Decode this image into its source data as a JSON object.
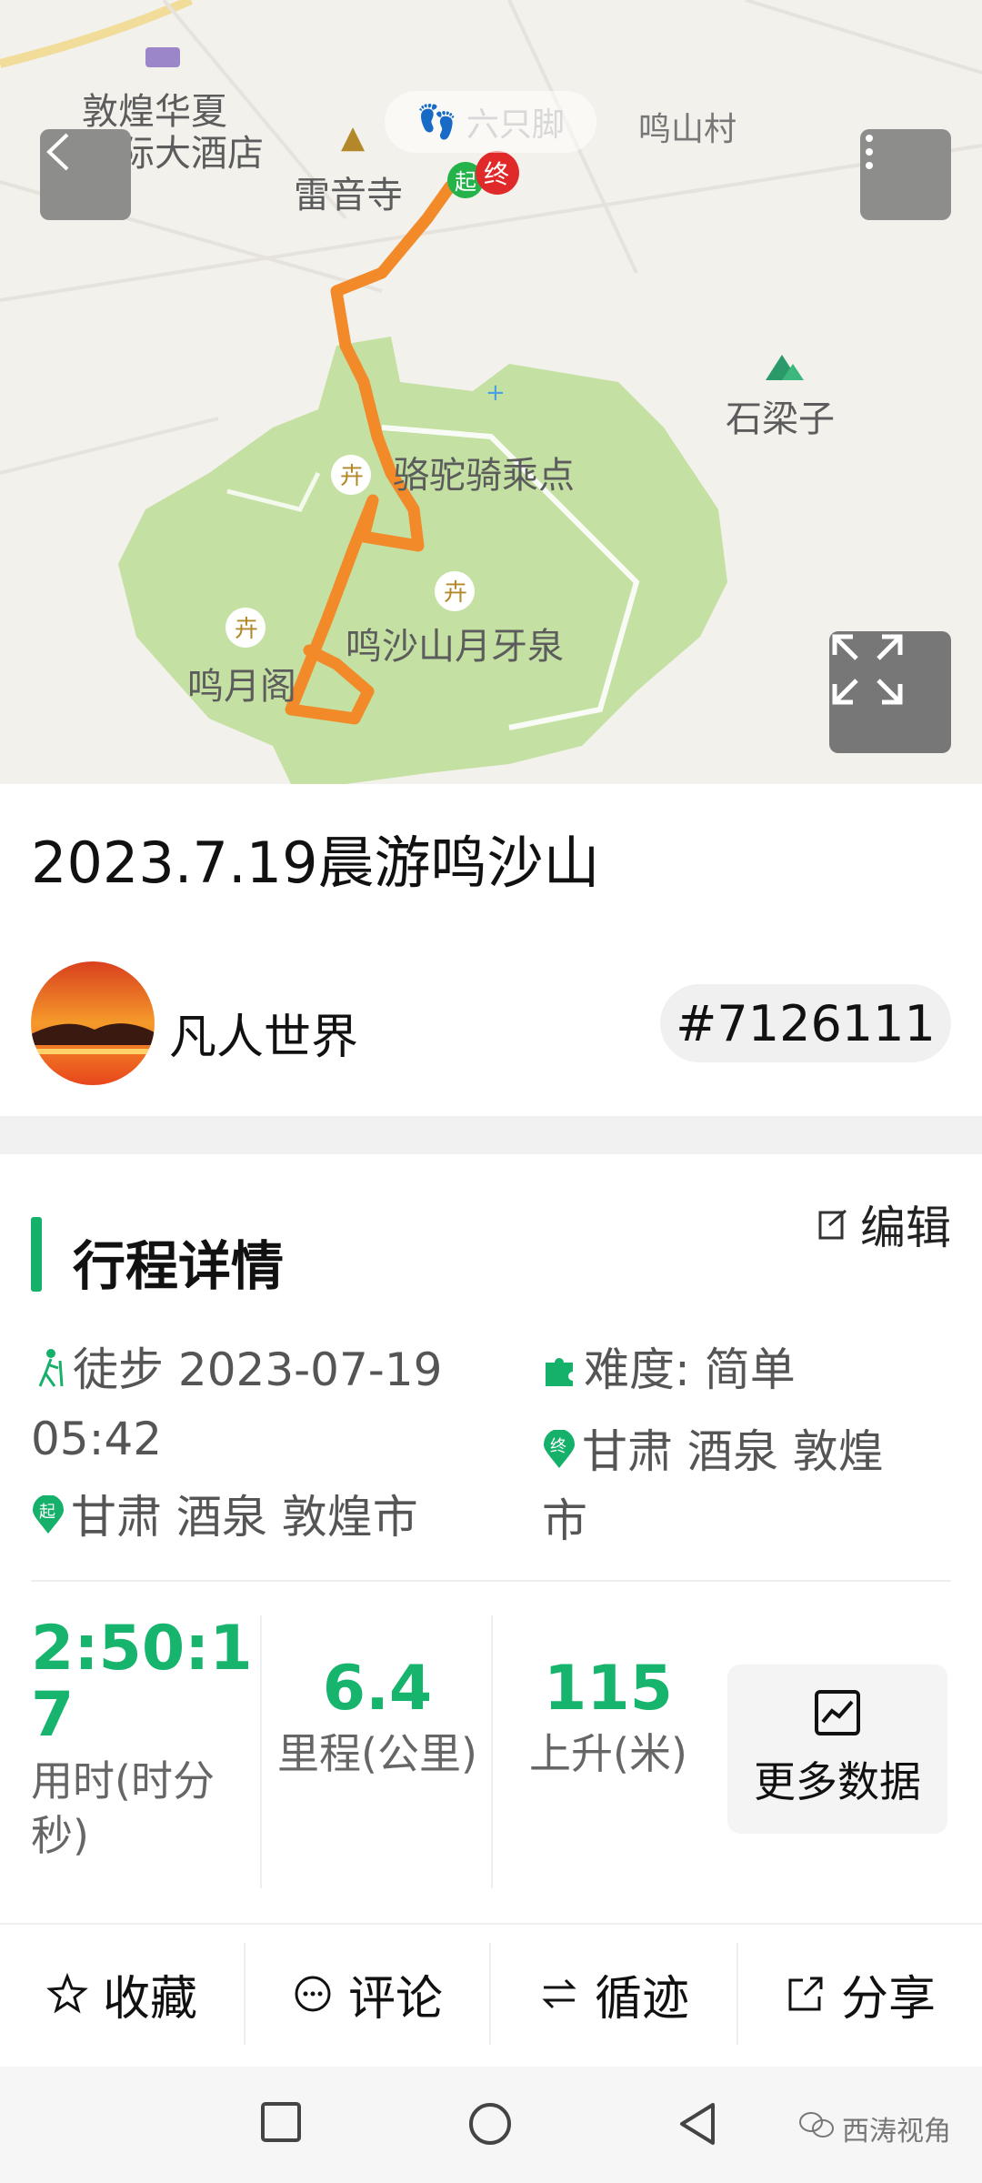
{
  "map": {
    "labels": {
      "hotel_line1": "敦煌华夏",
      "hotel_line2": "国际大酒店",
      "temple": "雷音寺",
      "village": "鸣山村",
      "stone": "石梁子",
      "camel": "骆驼骑乘点",
      "spring": "鸣沙山月牙泉",
      "pavilion": "鸣月阁"
    },
    "watermark": "六只脚",
    "start_marker": "起",
    "end_marker": "终",
    "colors": {
      "route": "#f28a2a",
      "park": "#c4e0a2",
      "land": "#f3f1ec"
    }
  },
  "trip": {
    "title": "2023.7.19晨游鸣沙山",
    "author": "凡人世界",
    "id_badge": "#7126111"
  },
  "details": {
    "section_title": "行程详情",
    "edit_label": "编辑",
    "activity": "徒步 2023-07-19",
    "time": "05:42",
    "difficulty": "难度:  简单",
    "start_place": "甘肃 酒泉 敦煌市",
    "end_place_line1": "甘肃 酒泉 敦煌",
    "end_place_line2": "市",
    "start_tag": "起",
    "end_tag": "终"
  },
  "stats": {
    "duration_line1": "2:50:1",
    "duration_line2": "7",
    "duration_label_line1": "用时(时分",
    "duration_label_line2": "秒)",
    "distance": "6.4",
    "distance_label": "里程(公里)",
    "ascent": "115",
    "ascent_label": "上升(米)",
    "more_label": "更多数据"
  },
  "actions": {
    "favorite": "收藏",
    "comment": "评论",
    "follow": "循迹",
    "share": "分享"
  },
  "footer": {
    "watermark": "西涛视角"
  },
  "accent_color": "#17b46d"
}
